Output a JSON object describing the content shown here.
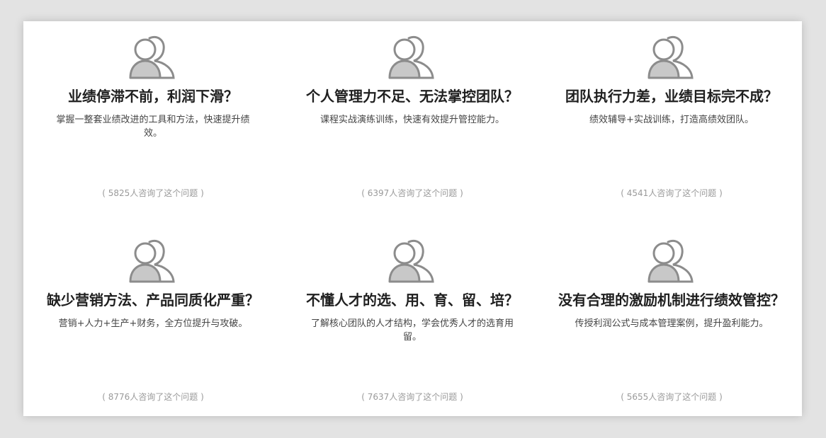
{
  "colors": {
    "background": "#e3e3e3",
    "panel": "#ffffff",
    "title": "#1f1f1f",
    "desc": "#444444",
    "count": "#9a9a9a",
    "icon_fill": "#c8c8c8",
    "icon_stroke": "#8c8c8c"
  },
  "icons": {
    "card_icon": "users-icon"
  },
  "cards": [
    {
      "title": "业绩停滞不前，利润下滑？",
      "description": "掌握一整套业绩改进的工具和方法，快速提升绩效。",
      "count_text": "( 5825人咨询了这个问题 )"
    },
    {
      "title": "个人管理力不足、无法掌控团队？",
      "description": "课程实战演练训练，快速有效提升管控能力。",
      "count_text": "( 6397人咨询了这个问题 )"
    },
    {
      "title": "团队执行力差，业绩目标完不成？",
      "description": "绩效辅导+实战训练，打造高绩效团队。",
      "count_text": "( 4541人咨询了这个问题 )"
    },
    {
      "title": "缺少营销方法、产品同质化严重？",
      "description": "营销+人力+生产+财务，全方位提升与攻破。",
      "count_text": "( 8776人咨询了这个问题 )"
    },
    {
      "title": "不懂人才的选、用、育、留、培？",
      "description": "了解核心团队的人才结构，学会优秀人才的选育用留。",
      "count_text": "( 7637人咨询了这个问题 )"
    },
    {
      "title": "没有合理的激励机制进行绩效管控？",
      "description": "传授利润公式与成本管理案例，提升盈利能力。",
      "count_text": "( 5655人咨询了这个问题 )"
    }
  ]
}
